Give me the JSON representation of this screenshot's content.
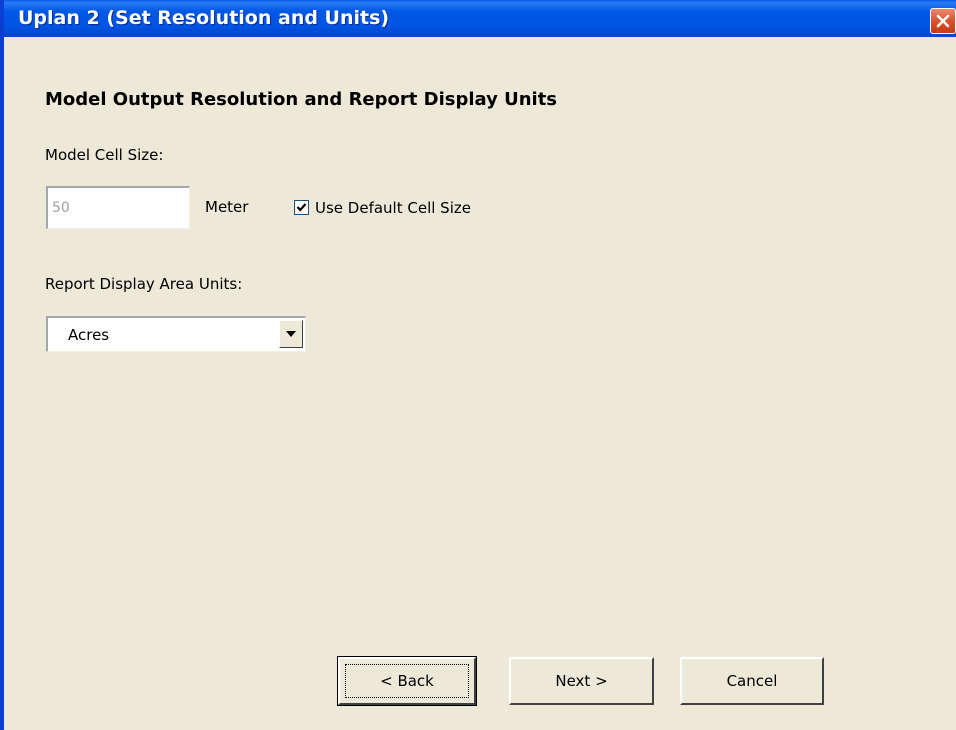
{
  "window": {
    "title": "Uplan 2 (Set Resolution and Units)",
    "close_icon": "close-icon"
  },
  "heading": "Model Output Resolution and Report Display Units",
  "cell_size": {
    "label": "Model Cell Size:",
    "value": "50",
    "unit": "Meter",
    "use_default_label": "Use Default Cell Size",
    "use_default_checked": true
  },
  "area_units": {
    "label": "Report Display Area Units:",
    "selected": "Acres"
  },
  "buttons": {
    "back": "< Back",
    "next": "Next >",
    "cancel": "Cancel"
  },
  "colors": {
    "titlebar": "#0054e3",
    "dialog_bg": "#ece9d8",
    "close_button": "#d9532c"
  }
}
